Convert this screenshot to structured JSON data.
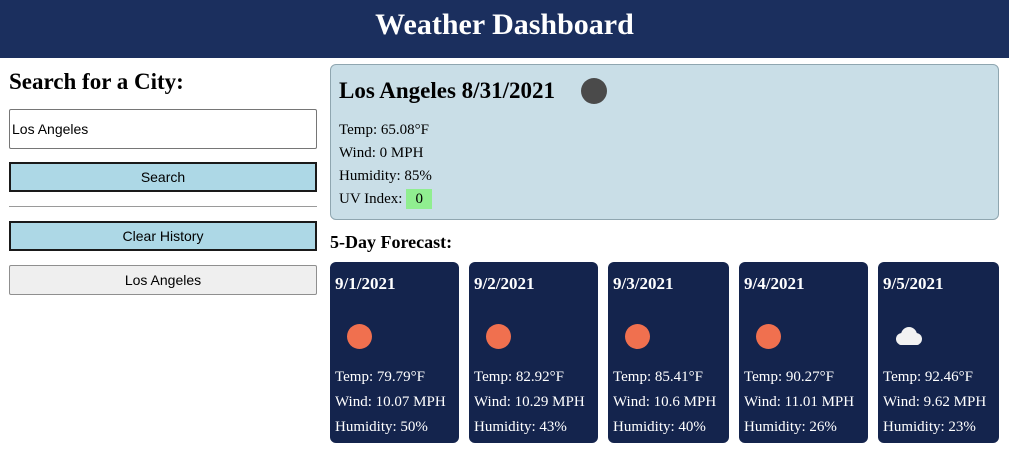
{
  "header": {
    "title": "Weather Dashboard"
  },
  "sidebar": {
    "heading": "Search for a City:",
    "search_value": "Los Angeles",
    "search_button": "Search",
    "clear_button": "Clear History",
    "history": [
      "Los Angeles"
    ]
  },
  "current": {
    "title": "Los Angeles 8/31/2021",
    "icon": "dark-circle-icon",
    "temp": "Temp: 65.08°F",
    "wind": "Wind: 0 MPH",
    "humidity": "Humidity: 85%",
    "uv_label": "UV Index:",
    "uv_value": "0",
    "uv_color": "#90ee90"
  },
  "forecast": {
    "title": "5-Day Forecast:",
    "days": [
      {
        "date": "9/1/2021",
        "icon": "sun-icon",
        "temp": "Temp: 79.79°F",
        "wind": "Wind: 10.07 MPH",
        "humidity": "Humidity: 50%"
      },
      {
        "date": "9/2/2021",
        "icon": "sun-icon",
        "temp": "Temp: 82.92°F",
        "wind": "Wind: 10.29 MPH",
        "humidity": "Humidity: 43%"
      },
      {
        "date": "9/3/2021",
        "icon": "sun-icon",
        "temp": "Temp: 85.41°F",
        "wind": "Wind: 10.6 MPH",
        "humidity": "Humidity: 40%"
      },
      {
        "date": "9/4/2021",
        "icon": "sun-icon",
        "temp": "Temp: 90.27°F",
        "wind": "Wind: 11.01 MPH",
        "humidity": "Humidity: 26%"
      },
      {
        "date": "9/5/2021",
        "icon": "cloud-icon",
        "temp": "Temp: 92.46°F",
        "wind": "Wind: 9.62 MPH",
        "humidity": "Humidity: 23%"
      }
    ]
  },
  "colors": {
    "header_bg": "#1b2f5e",
    "card_bg": "#14244d",
    "current_bg": "#c9dee7",
    "button_bg": "#add8e6",
    "sun": "#f0704f"
  }
}
